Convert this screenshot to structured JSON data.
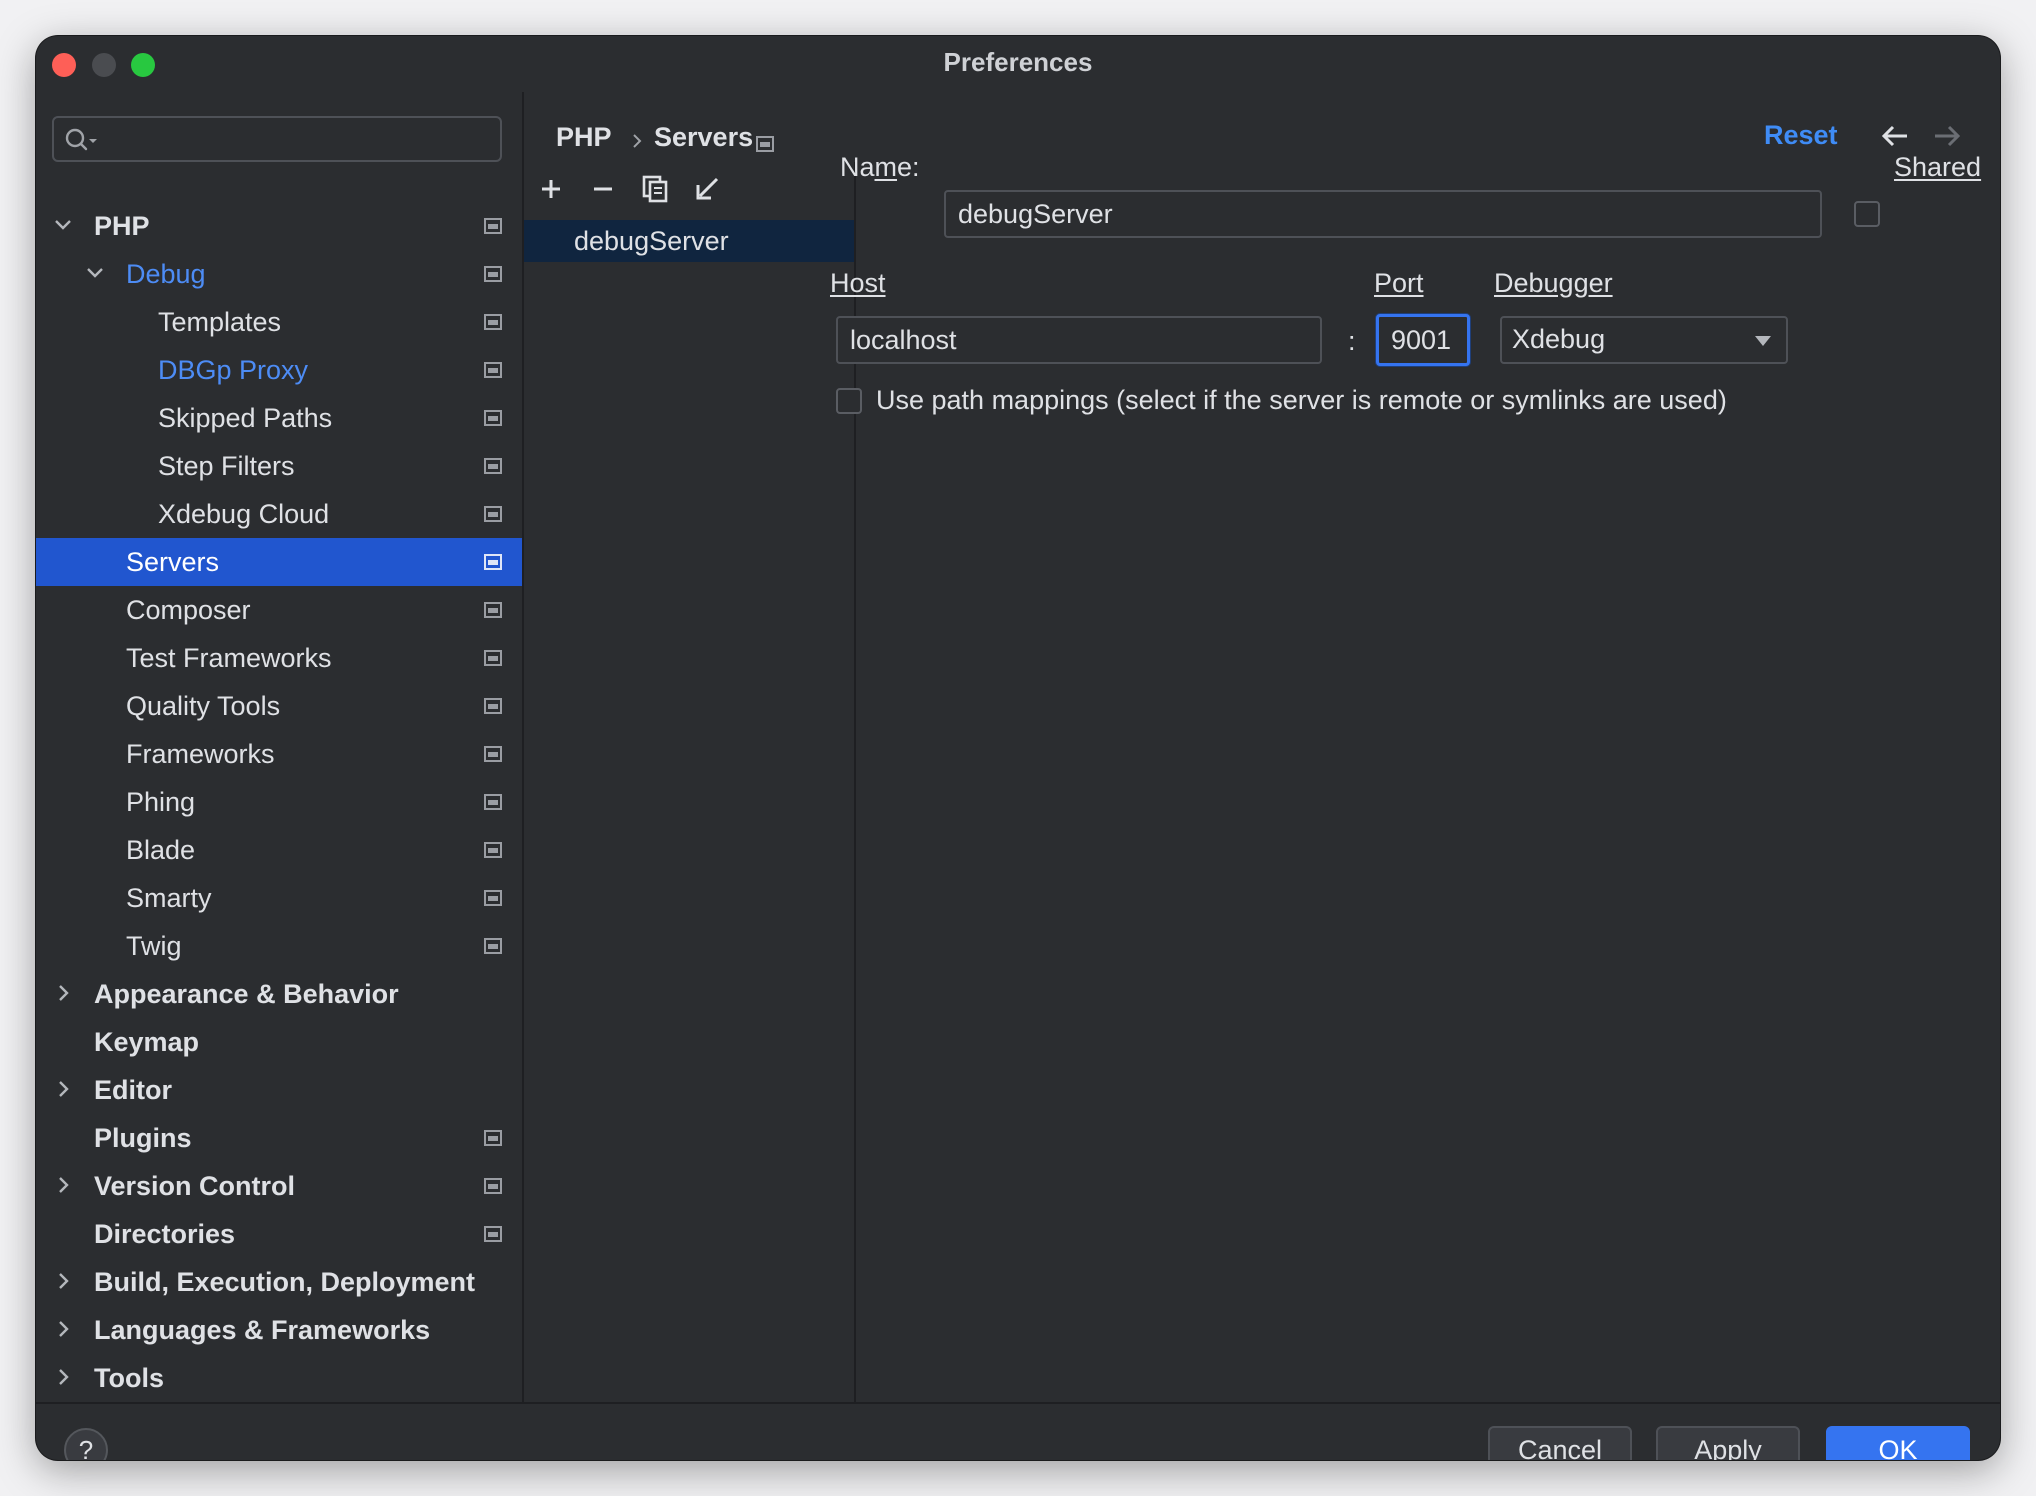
{
  "window": {
    "title": "Preferences"
  },
  "sidebar": {
    "search": {
      "placeholder": "",
      "value": ""
    },
    "items": [
      {
        "label": "PHP",
        "indent": 0,
        "chevron": "down",
        "bold": true,
        "project_icon": true,
        "name": "php"
      },
      {
        "label": "Debug",
        "indent": 1,
        "chevron": "down",
        "highlight": true,
        "project_icon": true,
        "name": "debug"
      },
      {
        "label": "Templates",
        "indent": 2,
        "project_icon": true,
        "name": "templates"
      },
      {
        "label": "DBGp Proxy",
        "indent": 2,
        "highlight": true,
        "project_icon": true,
        "name": "dbgp-proxy"
      },
      {
        "label": "Skipped Paths",
        "indent": 2,
        "project_icon": true,
        "name": "skipped-paths"
      },
      {
        "label": "Step Filters",
        "indent": 2,
        "project_icon": true,
        "name": "step-filters"
      },
      {
        "label": "Xdebug Cloud",
        "indent": 2,
        "project_icon": true,
        "name": "xdebug-cloud"
      },
      {
        "label": "Servers",
        "indent": 1,
        "selected": true,
        "project_icon": true,
        "name": "servers"
      },
      {
        "label": "Composer",
        "indent": 1,
        "project_icon": true,
        "name": "composer"
      },
      {
        "label": "Test Frameworks",
        "indent": 1,
        "project_icon": true,
        "name": "test-frameworks"
      },
      {
        "label": "Quality Tools",
        "indent": 1,
        "project_icon": true,
        "name": "quality-tools"
      },
      {
        "label": "Frameworks",
        "indent": 1,
        "project_icon": true,
        "name": "frameworks"
      },
      {
        "label": "Phing",
        "indent": 1,
        "project_icon": true,
        "name": "phing"
      },
      {
        "label": "Blade",
        "indent": 1,
        "project_icon": true,
        "name": "blade"
      },
      {
        "label": "Smarty",
        "indent": 1,
        "project_icon": true,
        "name": "smarty"
      },
      {
        "label": "Twig",
        "indent": 1,
        "project_icon": true,
        "name": "twig"
      },
      {
        "label": "Appearance & Behavior",
        "indent": 0,
        "chevron": "right",
        "bold": true,
        "name": "appearance-behavior"
      },
      {
        "label": "Keymap",
        "indent": 0,
        "bold": true,
        "name": "keymap"
      },
      {
        "label": "Editor",
        "indent": 0,
        "chevron": "right",
        "bold": true,
        "name": "editor"
      },
      {
        "label": "Plugins",
        "indent": 0,
        "bold": true,
        "project_icon": true,
        "name": "plugins"
      },
      {
        "label": "Version Control",
        "indent": 0,
        "chevron": "right",
        "bold": true,
        "project_icon": true,
        "name": "version-control"
      },
      {
        "label": "Directories",
        "indent": 0,
        "bold": true,
        "project_icon": true,
        "name": "directories"
      },
      {
        "label": "Build, Execution, Deployment",
        "indent": 0,
        "chevron": "right",
        "bold": true,
        "name": "build-execution-deployment"
      },
      {
        "label": "Languages & Frameworks",
        "indent": 0,
        "chevron": "right",
        "bold": true,
        "name": "languages-frameworks"
      },
      {
        "label": "Tools",
        "indent": 0,
        "chevron": "right",
        "bold": true,
        "name": "tools"
      }
    ]
  },
  "header": {
    "breadcrumb": [
      "PHP",
      "Servers"
    ],
    "reset_label": "Reset"
  },
  "servers": {
    "toolbar": [
      "add-icon",
      "remove-icon",
      "copy-icon",
      "import-icon"
    ],
    "items": [
      "debugServer"
    ]
  },
  "form": {
    "name_label_pre": "Na",
    "name_label_mnemonic": "m",
    "name_label_post": "e:",
    "name_value": "debugServer",
    "shared_label": "Shared",
    "host_label": "Host",
    "host_value": "localhost",
    "colon": ":",
    "port_label": "Port",
    "port_value": "9001",
    "debugger_label": "Debugger",
    "debugger_value": "Xdebug",
    "path_mappings_label": "Use path mappings (select if the server is remote or symlinks are used)"
  },
  "footer": {
    "help_label": "?",
    "cancel_label": "Cancel",
    "apply_label": "Apply",
    "ok_label": "OK"
  },
  "colors": {
    "background": "#2b2d30",
    "selection": "#2156cf",
    "accent": "#3574f0",
    "link": "#4d8cf5"
  }
}
